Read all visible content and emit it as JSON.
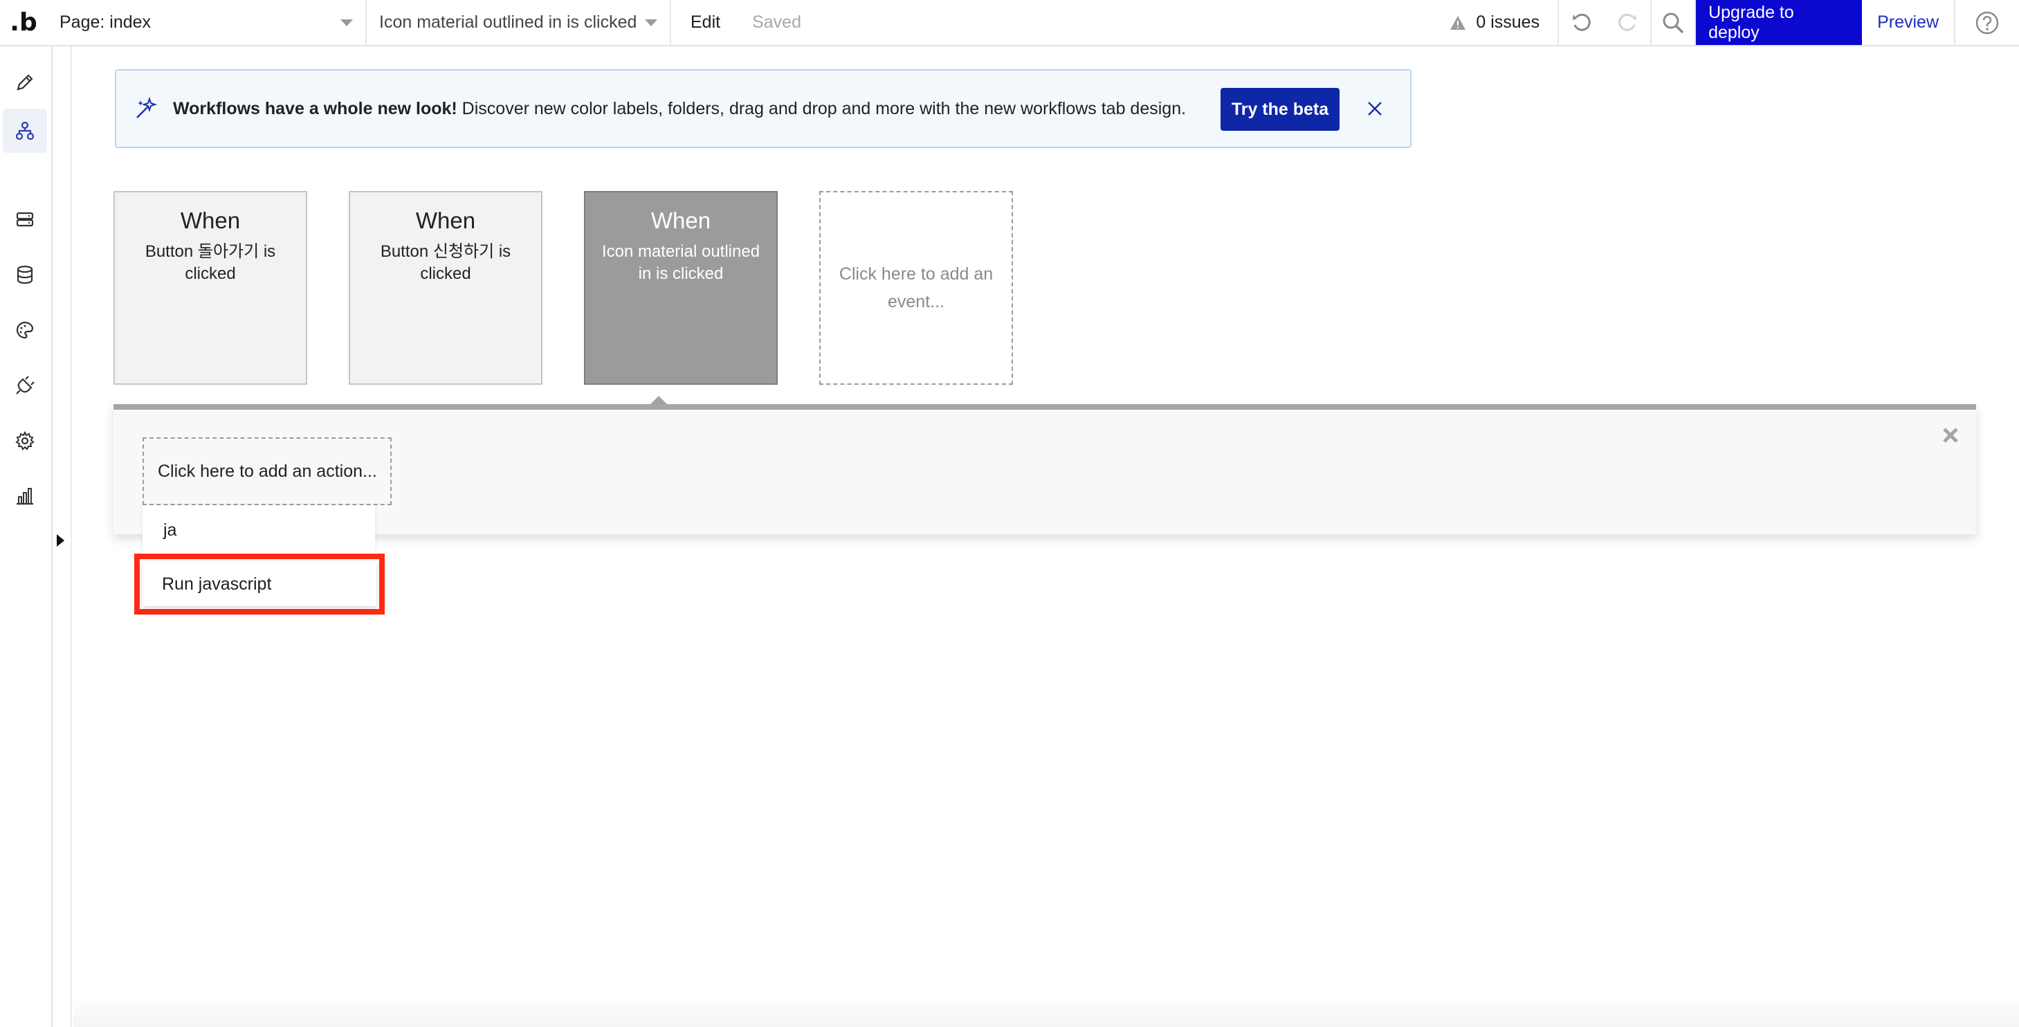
{
  "topbar": {
    "logo": ".b",
    "page_select": "Page: index",
    "event_select": "Icon material outlined in is clicked",
    "edit": "Edit",
    "saved": "Saved",
    "issues": "0 issues",
    "deploy": "Upgrade to deploy",
    "preview": "Preview"
  },
  "sidebar": {
    "items": [
      {
        "icon": "pencil-icon"
      },
      {
        "icon": "workflow-icon",
        "active": true
      },
      {
        "icon": "server-icon"
      },
      {
        "icon": "database-icon"
      },
      {
        "icon": "palette-icon"
      },
      {
        "icon": "plug-icon"
      },
      {
        "icon": "gear-icon"
      },
      {
        "icon": "bar-chart-icon"
      }
    ]
  },
  "banner": {
    "title": "Workflows have a whole new look!",
    "text": " Discover new color labels, folders, drag and drop and more with the new workflows tab design.",
    "button": "Try the beta"
  },
  "events": [
    {
      "when": "When",
      "desc": "Button 돌아가기 is clicked"
    },
    {
      "when": "When",
      "desc": "Button 신청하기 is clicked"
    },
    {
      "when": "When",
      "desc": "Icon material outlined in is clicked",
      "selected": true
    },
    {
      "desc": "Click here to add an event..."
    }
  ],
  "action_panel": {
    "add_action": "Click here to add an action..."
  },
  "dropdown": {
    "search_value": "ja",
    "result": "Run javascript"
  },
  "colors": {
    "accent": "#0b09cf",
    "highlight": "#ff2a12",
    "selected_event": "#9b9b9b"
  }
}
